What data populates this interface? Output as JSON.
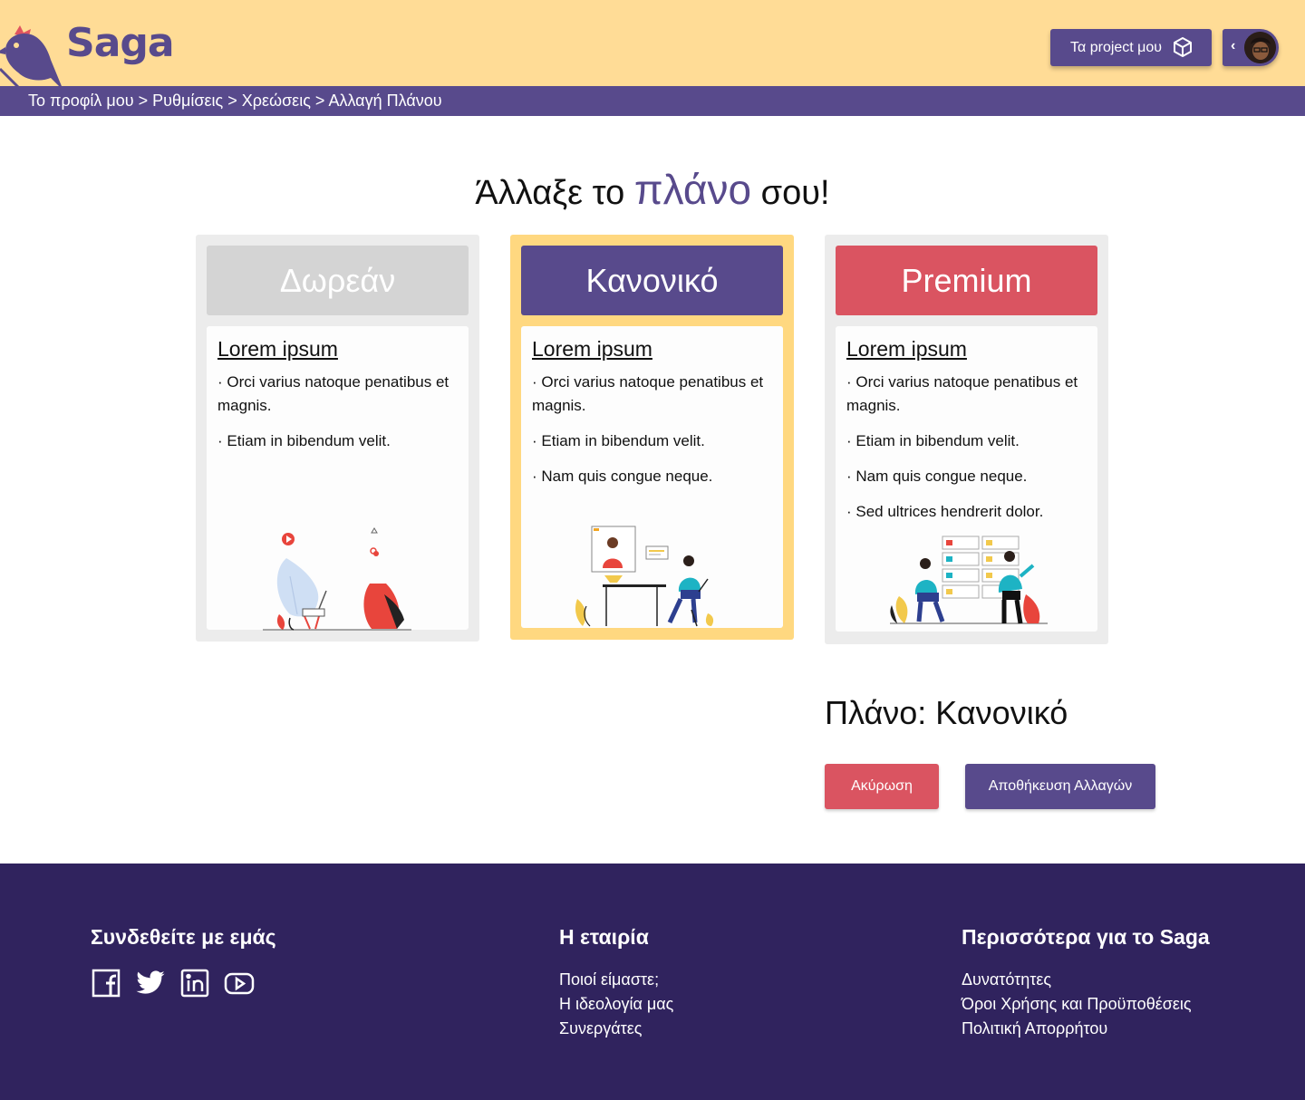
{
  "brand": {
    "name": "Saga",
    "primary": "#584a8c",
    "header_bg": "#ffdc96",
    "footer_bg": "#30235e",
    "danger": "#da5461"
  },
  "header": {
    "projects_label": "Τα project μου"
  },
  "breadcrumb": [
    "Το προφίλ μου",
    "Ρυθμίσεις",
    "Χρεώσεις",
    "Αλλαγή Πλάνου"
  ],
  "breadcrumb_sep": ">",
  "title": {
    "before": "Άλλαξε το",
    "accent": "πλάνο",
    "after": "σου!"
  },
  "plans": [
    {
      "name": "Δωρεάν",
      "color": "#d4d4d4",
      "heading": "Lorem ipsum",
      "features": [
        "· Orci varius natoque penatibus et magnis.",
        "· Etiam in bibendum velit."
      ]
    },
    {
      "name": "Κανονικό",
      "color": "#584a8c",
      "selected": true,
      "heading": "Lorem ipsum",
      "features": [
        "· Orci varius natoque penatibus et magnis.",
        "· Etiam in bibendum velit.",
        "· Nam quis congue neque."
      ]
    },
    {
      "name": "Premium",
      "color": "#da5461",
      "heading": "Lorem ipsum",
      "features": [
        "· Orci varius natoque penatibus et magnis.",
        "· Etiam in bibendum velit.",
        "· Nam quis congue neque.",
        "· Sed ultrices hendrerit dolor."
      ]
    }
  ],
  "summary": {
    "plan_label": "Πλάνο: Κανονικό",
    "cancel": "Ακύρωση",
    "save": "Αποθήκευση Αλλαγών"
  },
  "footer": {
    "connect_title": "Συνδεθείτε με εμάς",
    "socials": [
      "facebook-icon",
      "twitter-icon",
      "linkedin-icon",
      "youtube-icon"
    ],
    "company_title": "Η εταιρία",
    "company_links": [
      "Ποιοί είμαστε;",
      "Η ιδεολογία μας",
      "Συνεργάτες"
    ],
    "more_title": "Περισσότερα για το Saga",
    "more_links": [
      "Δυνατότητες",
      "Όροι Χρήσης και Προϋποθέσεις",
      "Πολιτική Απορρήτου"
    ]
  }
}
